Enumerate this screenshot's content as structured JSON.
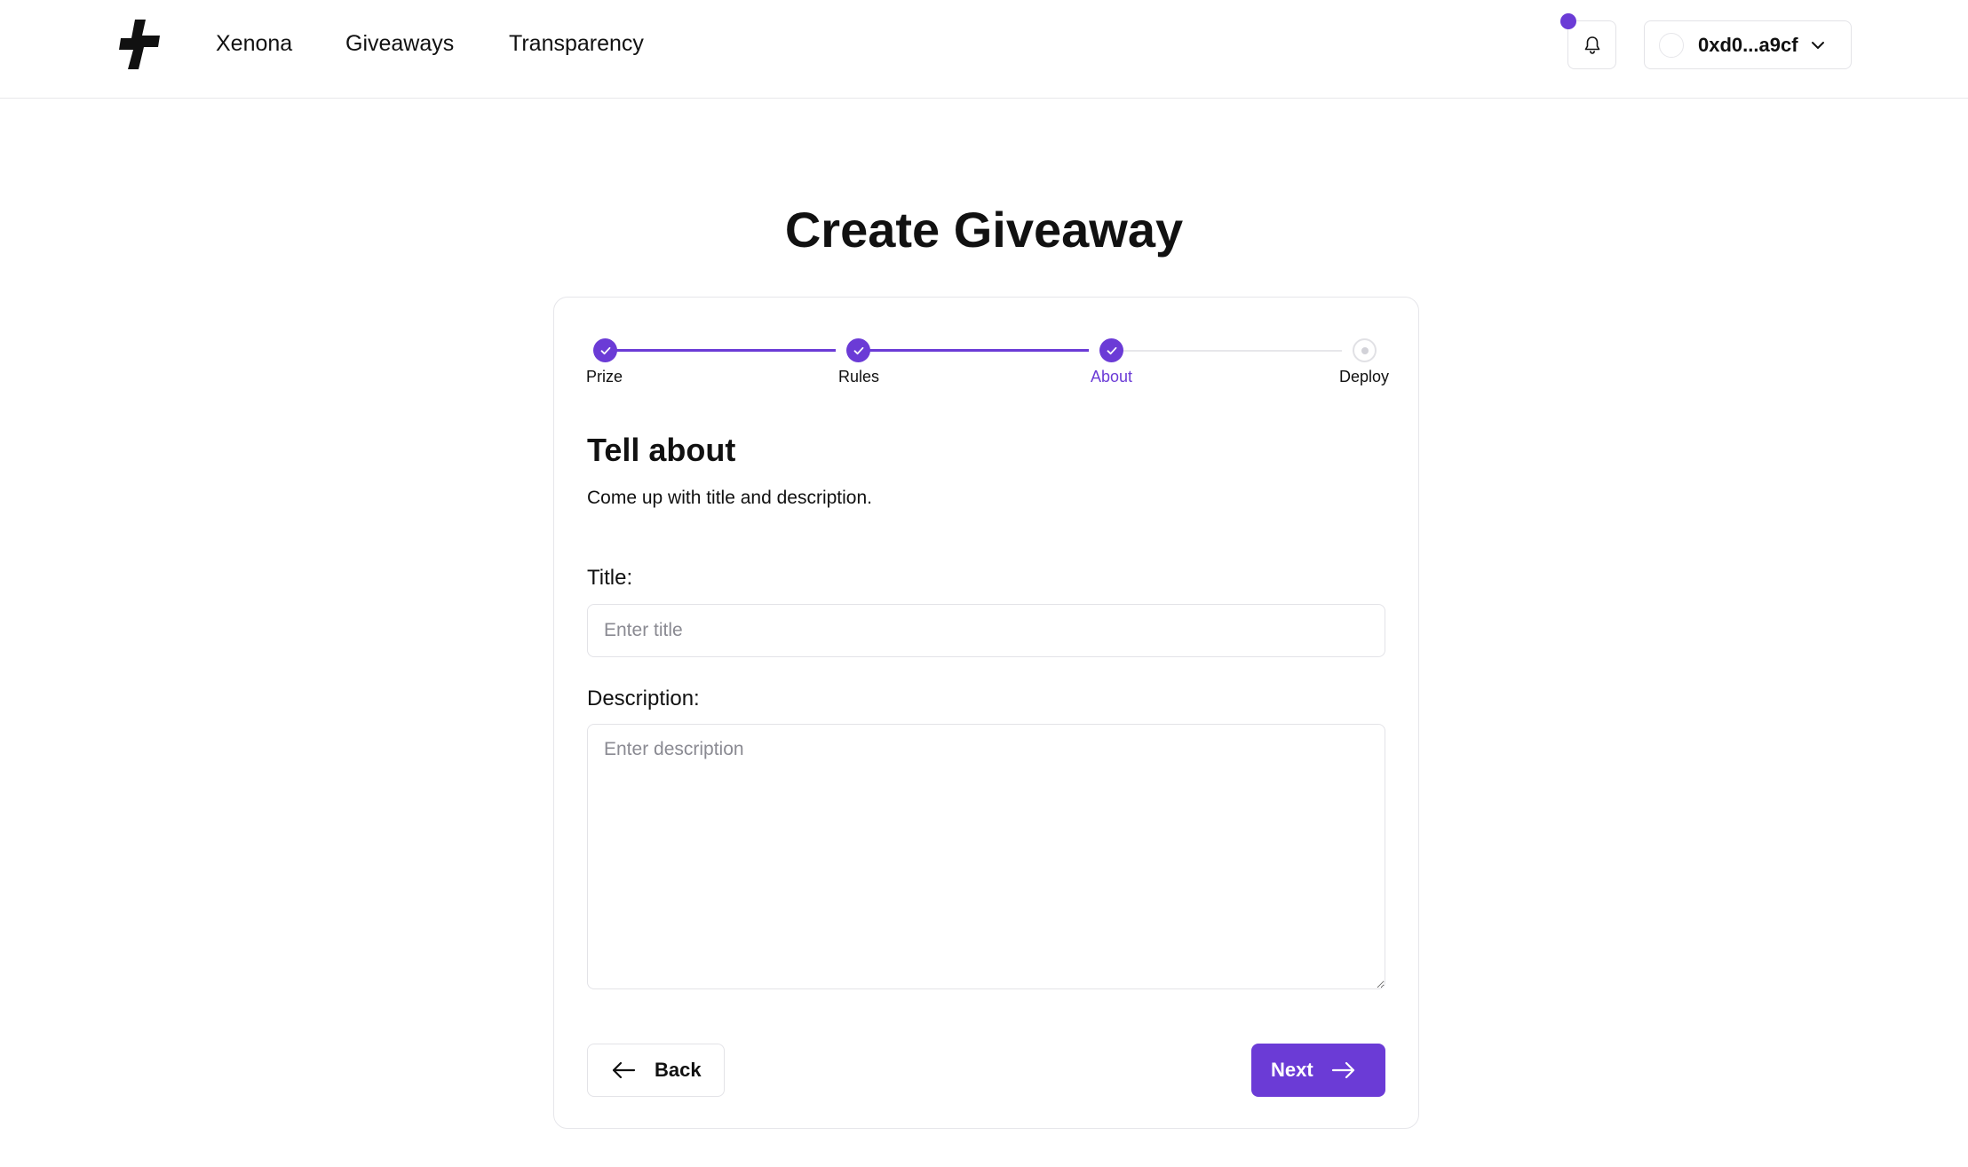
{
  "header": {
    "nav": [
      {
        "label": "Xenona"
      },
      {
        "label": "Giveaways"
      },
      {
        "label": "Transparency"
      }
    ],
    "wallet": {
      "address": "0xd0...a9cf"
    },
    "notification_dot_color": "#6b3bd6"
  },
  "page": {
    "title": "Create Giveaway"
  },
  "stepper": {
    "steps": [
      {
        "label": "Prize",
        "status": "complete"
      },
      {
        "label": "Rules",
        "status": "complete"
      },
      {
        "label": "About",
        "status": "current"
      },
      {
        "label": "Deploy",
        "status": "pending"
      }
    ],
    "accent_color": "#6b3bd6"
  },
  "form": {
    "heading": "Tell about",
    "subheading": "Come up with title and description.",
    "title_label": "Title:",
    "title_placeholder": "Enter title",
    "title_value": "",
    "description_label": "Description:",
    "description_placeholder": "Enter description",
    "description_value": ""
  },
  "actions": {
    "back_label": "Back",
    "next_label": "Next"
  }
}
